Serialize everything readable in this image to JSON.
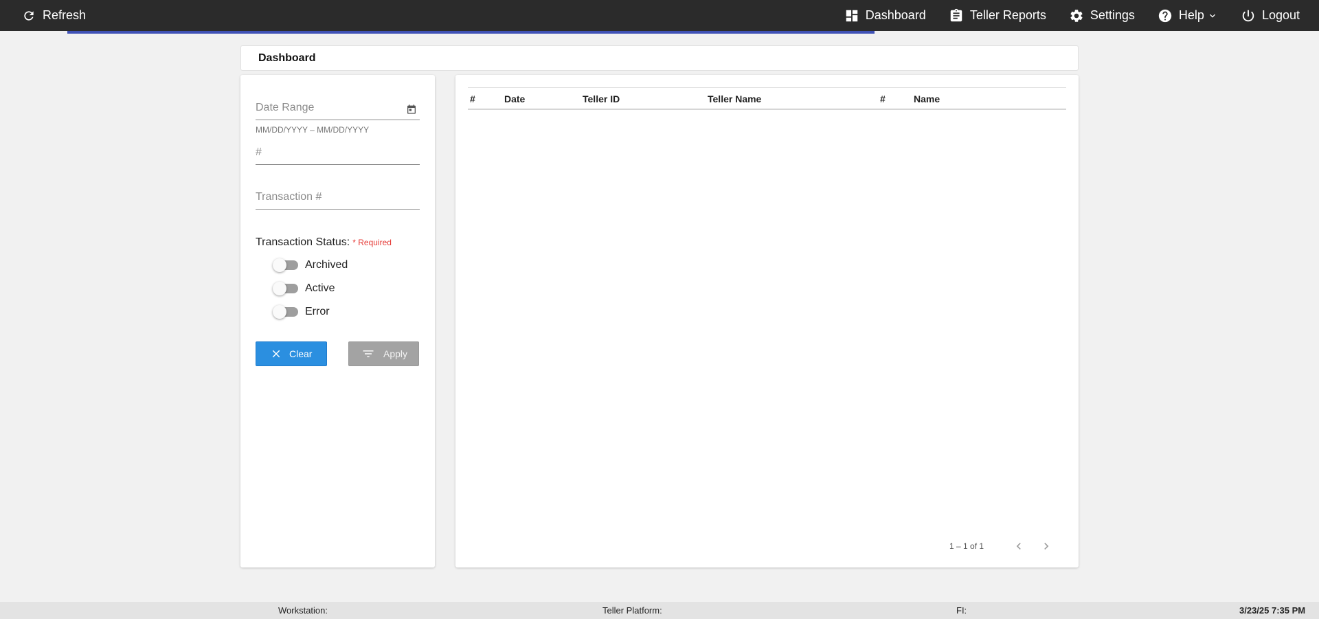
{
  "topbar": {
    "refresh_label": "Refresh",
    "nav": [
      {
        "label": "Dashboard",
        "icon": "dashboard-icon"
      },
      {
        "label": "Teller Reports",
        "icon": "clipboard-icon"
      },
      {
        "label": "Settings",
        "icon": "gear-icon"
      },
      {
        "label": "Help",
        "icon": "help-icon"
      },
      {
        "label": "Logout",
        "icon": "power-icon"
      }
    ]
  },
  "page": {
    "title": "Dashboard"
  },
  "filters": {
    "date_range_placeholder": "Date Range",
    "date_hint": "MM/DD/YYYY – MM/DD/YYYY",
    "number_placeholder": "#",
    "transaction_placeholder": "Transaction #",
    "status_label": "Transaction Status:",
    "required_label": "* Required",
    "statuses": [
      {
        "label": "Archived",
        "checked": false
      },
      {
        "label": "Active",
        "checked": false
      },
      {
        "label": "Error",
        "checked": false
      }
    ],
    "clear_label": "Clear",
    "apply_label": "Apply"
  },
  "table": {
    "columns": [
      "#",
      "Date",
      "Teller ID",
      "Teller Name",
      "#",
      "Name"
    ],
    "rows": [],
    "pagination": "1 – 1 of 1"
  },
  "footer": {
    "workstation_label": "Workstation:",
    "platform_label": "Teller Platform:",
    "fi_label": "FI:",
    "datetime": "3/23/25 7:35 PM"
  },
  "colors": {
    "topbar": "#2b2b2b",
    "progress": "#3f51b5",
    "clear_button": "#2b8fe0",
    "apply_button": "#a3a3a3",
    "required": "#e53935"
  }
}
